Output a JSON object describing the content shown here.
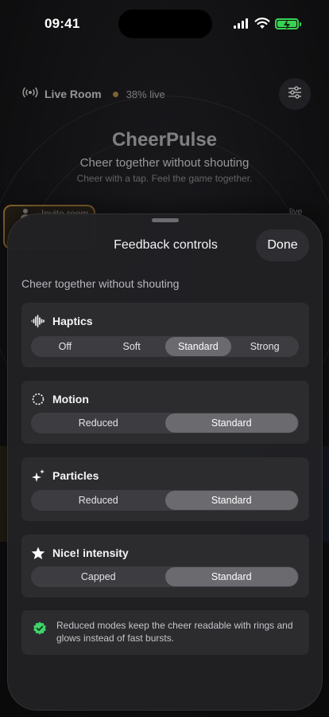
{
  "status_bar": {
    "time": "09:41"
  },
  "background": {
    "live_room_label": "Live Room",
    "live_percent": "38% live",
    "app_name": "CheerPulse",
    "tagline": "Cheer together without shouting",
    "caption": "Cheer with a tap. Feel the game together.",
    "invite_label": "Invite room",
    "live_tag": "live"
  },
  "sheet": {
    "title": "Feedback controls",
    "done_label": "Done",
    "subtitle": "Cheer together without shouting",
    "groups": [
      {
        "label": "Haptics",
        "icon": "waveform-icon",
        "options": [
          "Off",
          "Soft",
          "Standard",
          "Strong"
        ],
        "selected": "Standard"
      },
      {
        "label": "Motion",
        "icon": "dashed-circle-icon",
        "options": [
          "Reduced",
          "Standard"
        ],
        "selected": "Standard"
      },
      {
        "label": "Particles",
        "icon": "sparkles-icon",
        "options": [
          "Reduced",
          "Standard"
        ],
        "selected": "Standard"
      },
      {
        "label": "Nice! intensity",
        "icon": "star-icon",
        "options": [
          "Capped",
          "Standard"
        ],
        "selected": "Standard"
      }
    ],
    "info_text": "Reduced modes keep the cheer readable with rings and glows instead of fast bursts.",
    "info_icon": "checkmark-seal-icon"
  },
  "colors": {
    "accent_green": "#39d353",
    "segment_selected": "#6a6a6f",
    "sheet_background": "#212124",
    "card_background": "#2c2c2f"
  }
}
